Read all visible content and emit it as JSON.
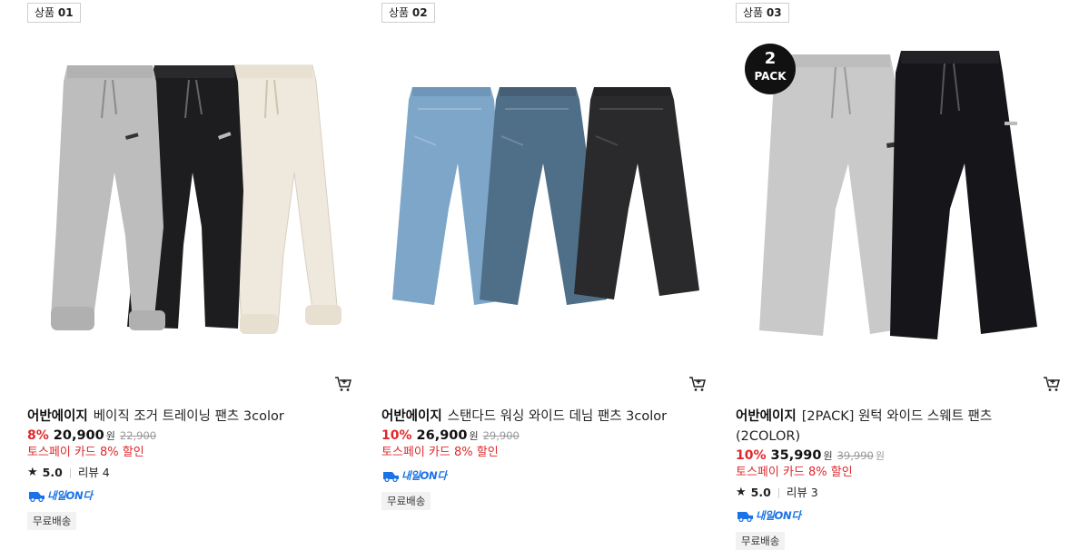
{
  "products": [
    {
      "rank_label": "상품",
      "rank_no": "01",
      "brand": "어반에이지",
      "title": "베이직 조거 트레이닝 팬츠 3color",
      "discount": "8%",
      "price": "20,900",
      "currency": "원",
      "original_price": "22,900",
      "promo": "토스페이 카드 8% 할인",
      "rating": "5.0",
      "reviews": "리뷰 4",
      "tomorrow_badge": "내일ON다",
      "shipping": "무료배송",
      "image_icon": "pants-photo",
      "colors": [
        "#bdbdbd",
        "#1b1b1b",
        "#efe9dd"
      ]
    },
    {
      "rank_label": "상품",
      "rank_no": "02",
      "brand": "어반에이지",
      "title": "스탠다드 워싱 와이드 데님 팬츠 3color",
      "discount": "10%",
      "price": "26,900",
      "currency": "원",
      "original_price": "29,900",
      "promo": "토스페이 카드 8% 할인",
      "tomorrow_badge": "내일ON다",
      "shipping": "무료배송",
      "image_icon": "jeans-photo",
      "colors": [
        "#7da6c9",
        "#4f6f88",
        "#2a2a2c"
      ]
    },
    {
      "rank_label": "상품",
      "rank_no": "03",
      "brand": "어반에이지",
      "title": "[2PACK] 원턱 와이드 스웨트 팬츠 (2COLOR)",
      "discount": "10%",
      "price": "35,990",
      "currency": "원",
      "original_price": "39,990",
      "promo": "토스페이 카드 8% 할인",
      "rating": "5.0",
      "reviews": "리뷰 3",
      "tomorrow_badge": "내일ON다",
      "shipping": "무료배송",
      "pack_badge_num": "2",
      "pack_badge_text": "PACK",
      "image_icon": "sweatpants-photo",
      "colors": [
        "#c9c9c9",
        "#16161a"
      ]
    }
  ],
  "accent_colors": {
    "discount": "#e0282c",
    "tomorrow": "#1a73e8"
  },
  "icons": {
    "cart": "cart-icon",
    "star": "★"
  }
}
